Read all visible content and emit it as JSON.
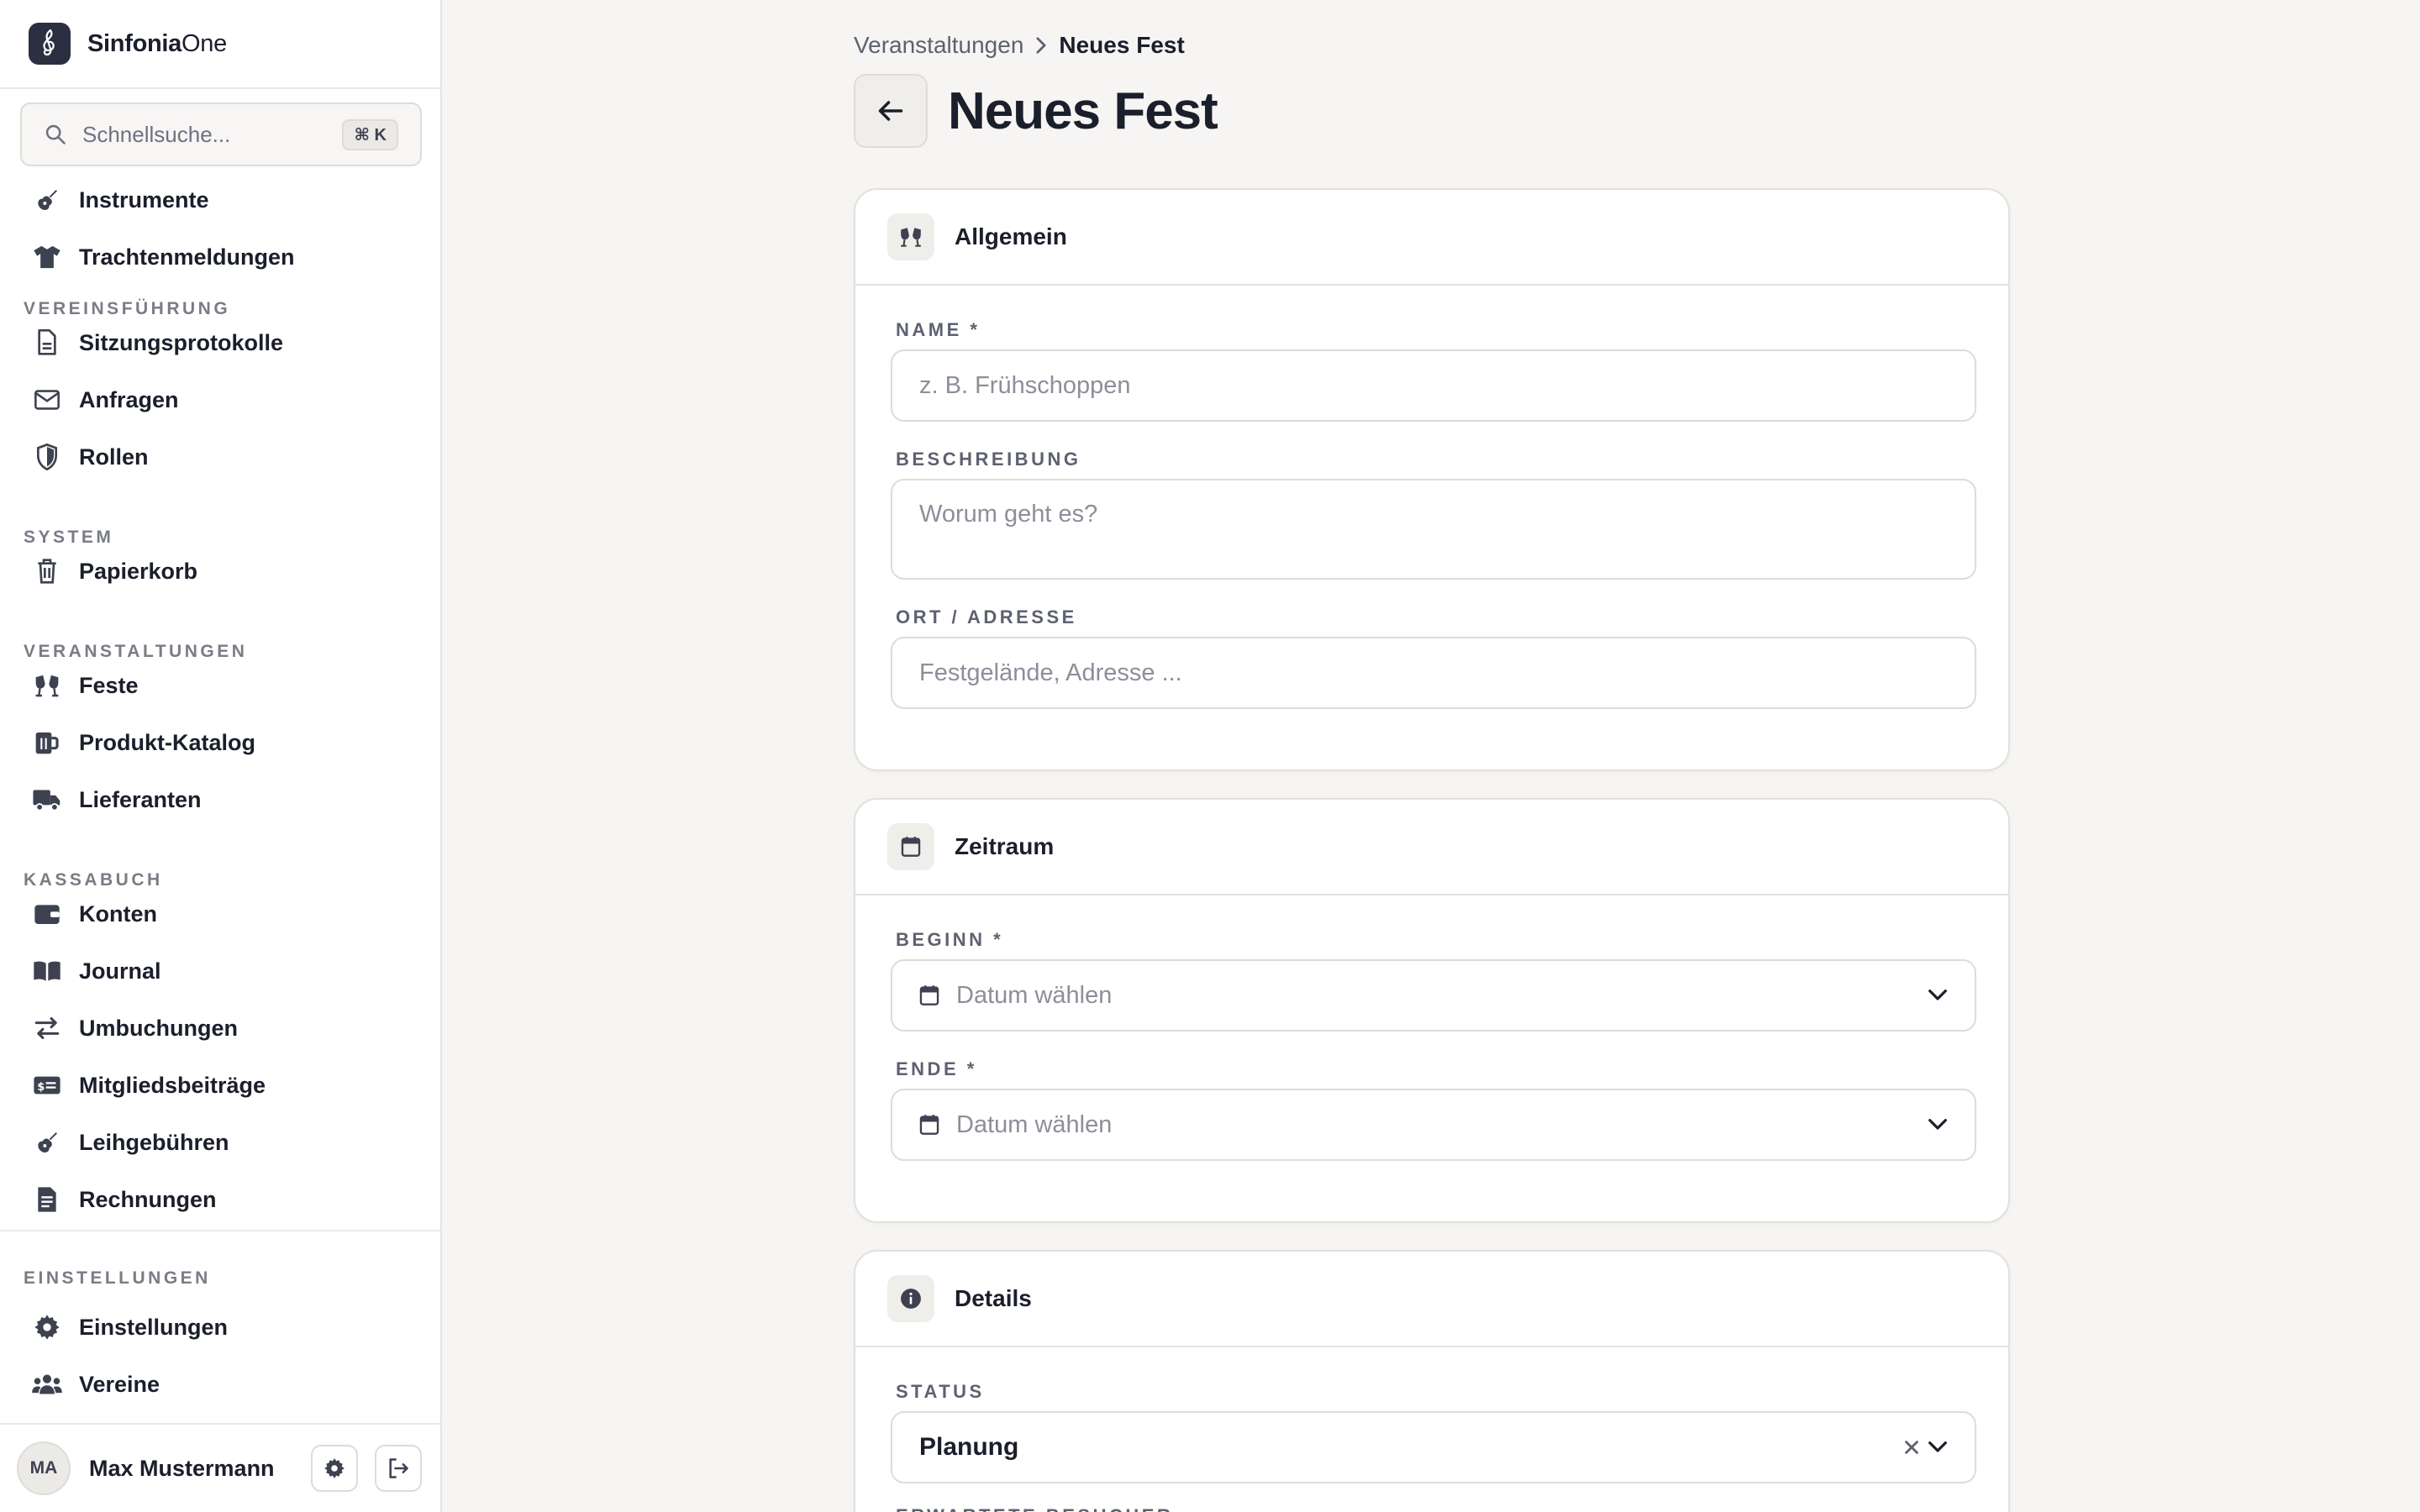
{
  "brand": {
    "name_main": "Sinfonia",
    "name_suffix": "One"
  },
  "search": {
    "placeholder": "Schnellsuche...",
    "shortcut": "⌘ K"
  },
  "sidebar": {
    "items_top": [
      {
        "label": "Instrumente",
        "icon": "guitar-icon"
      },
      {
        "label": "Trachtenmeldungen",
        "icon": "shirt-icon"
      }
    ],
    "sections": [
      {
        "title": "VEREINSFÜHRUNG",
        "items": [
          {
            "label": "Sitzungsprotokolle",
            "icon": "document-icon"
          },
          {
            "label": "Anfragen",
            "icon": "mail-icon"
          },
          {
            "label": "Rollen",
            "icon": "shield-icon"
          }
        ]
      },
      {
        "title": "SYSTEM",
        "items": [
          {
            "label": "Papierkorb",
            "icon": "trash-icon"
          }
        ]
      },
      {
        "title": "VERANSTALTUNGEN",
        "items": [
          {
            "label": "Feste",
            "icon": "glasses-cheers-icon"
          },
          {
            "label": "Produkt-Katalog",
            "icon": "beer-mug-icon"
          },
          {
            "label": "Lieferanten",
            "icon": "truck-icon"
          }
        ]
      },
      {
        "title": "KASSABUCH",
        "items": [
          {
            "label": "Konten",
            "icon": "wallet-icon"
          },
          {
            "label": "Journal",
            "icon": "book-open-icon"
          },
          {
            "label": "Umbuchungen",
            "icon": "arrows-transfer-icon"
          },
          {
            "label": "Mitgliedsbeiträge",
            "icon": "money-card-icon"
          },
          {
            "label": "Leihgebühren",
            "icon": "guitar-icon"
          },
          {
            "label": "Rechnungen",
            "icon": "invoice-icon"
          }
        ]
      }
    ],
    "settings": {
      "title": "EINSTELLUNGEN",
      "items": [
        {
          "label": "Einstellungen",
          "icon": "gear-icon"
        },
        {
          "label": "Vereine",
          "icon": "users-icon"
        }
      ]
    }
  },
  "user": {
    "initials": "MA",
    "name": "Max Mustermann"
  },
  "breadcrumb": {
    "parent": "Veranstaltungen",
    "current": "Neues Fest"
  },
  "page": {
    "title": "Neues Fest"
  },
  "cards": {
    "general": {
      "title": "Allgemein",
      "name_label": "NAME *",
      "name_placeholder": "z. B. Frühschoppen",
      "description_label": "BESCHREIBUNG",
      "description_placeholder": "Worum geht es?",
      "location_label": "ORT / ADRESSE",
      "location_placeholder": "Festgelände, Adresse ..."
    },
    "period": {
      "title": "Zeitraum",
      "start_label": "BEGINN *",
      "start_placeholder": "Datum wählen",
      "end_label": "ENDE *",
      "end_placeholder": "Datum wählen"
    },
    "details": {
      "title": "Details",
      "status_label": "STATUS",
      "status_value": "Planung",
      "next_label": "ERWARTETE BESUCHER"
    }
  },
  "colors": {
    "accent": "#2a3042",
    "background": "#f6f5f3",
    "border": "#dedcd7",
    "text": "#1b1e2b",
    "muted": "#7a7c86"
  }
}
